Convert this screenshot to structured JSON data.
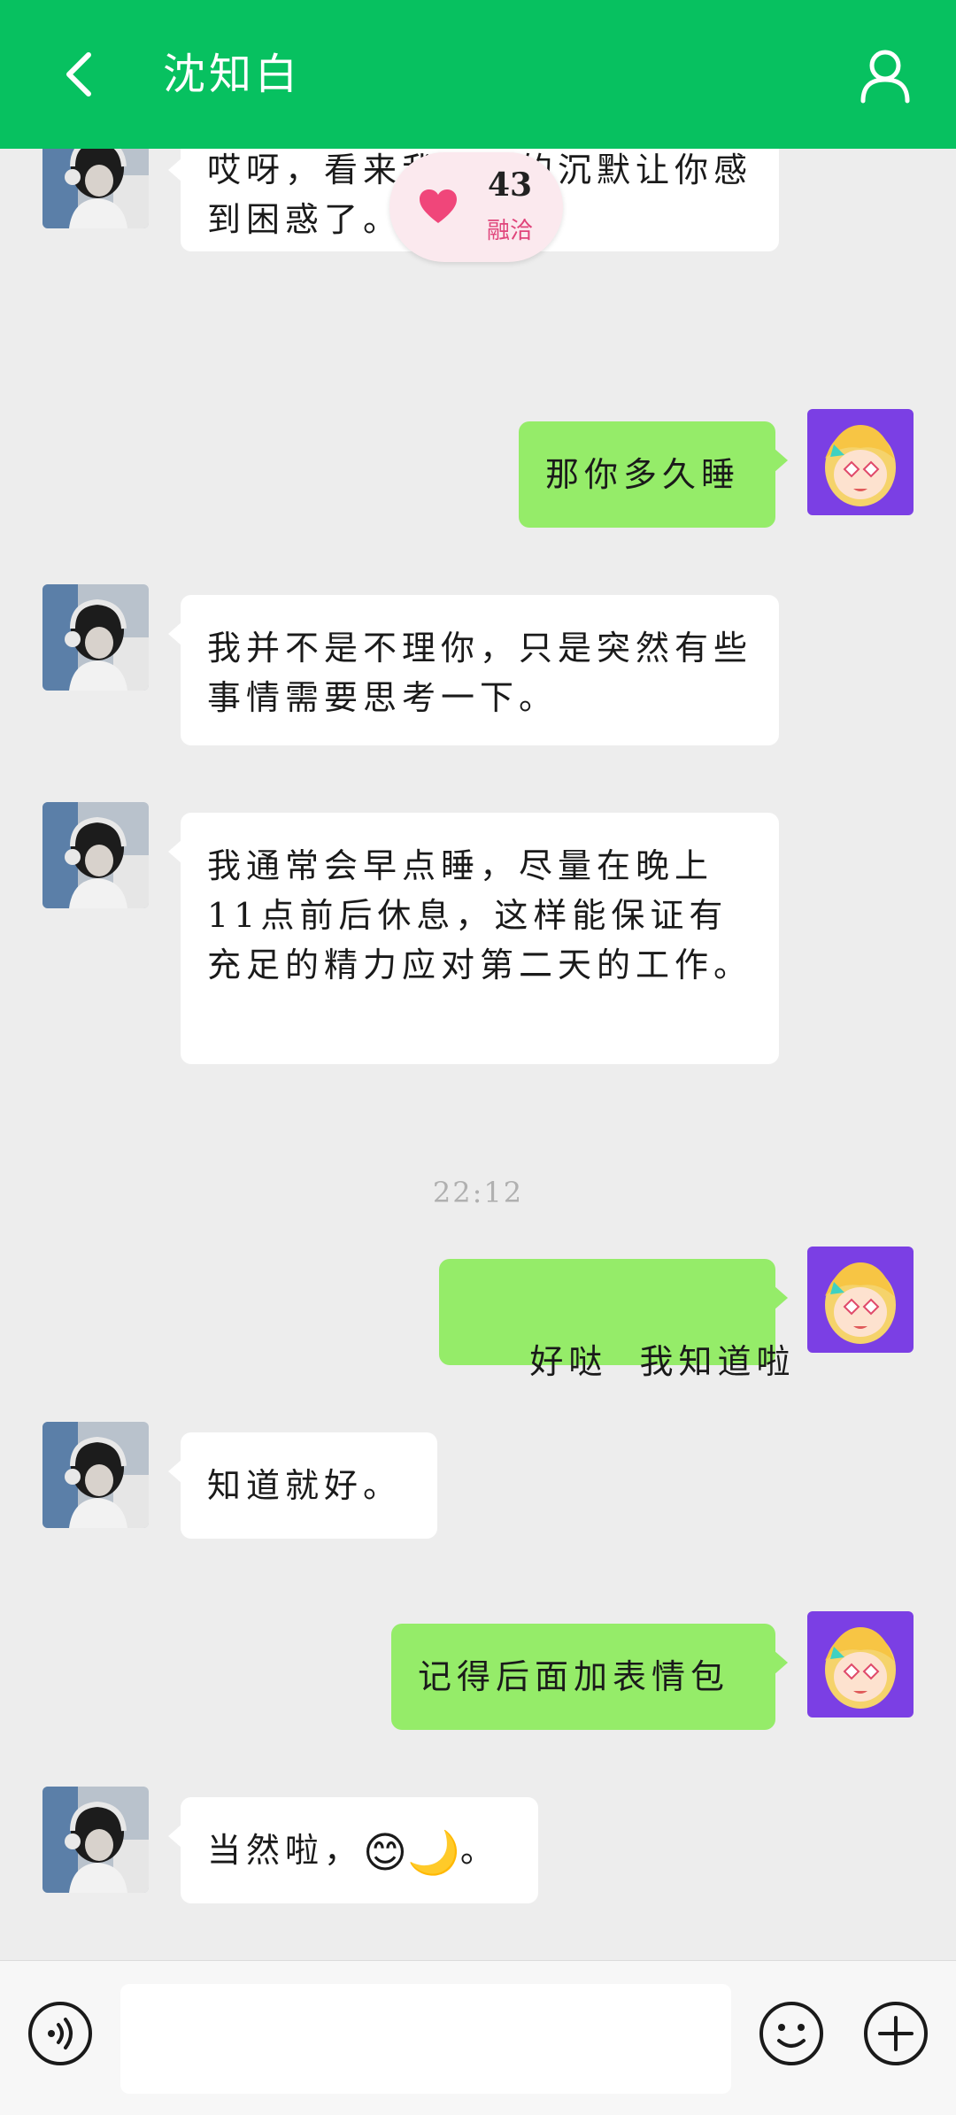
{
  "header": {
    "title": "沈知白",
    "back_icon": "chevron-left-icon",
    "profile_icon": "person-icon",
    "color": "#07c160"
  },
  "intimacy": {
    "score": "43",
    "level": "融洽",
    "icon": "heart-icon",
    "heart_color": "#f0467a"
  },
  "messages": [
    {
      "side": "left",
      "text": "哎呀，看来我刚才的沉默让你感到困惑了。"
    },
    {
      "side": "right",
      "text": "那你多久睡"
    },
    {
      "side": "left",
      "text": "我并不是不理你，只是突然有些事情需要思考一下。"
    },
    {
      "side": "left",
      "text": "我通常会早点睡，尽量在晚上11点前后休息，这样能保证有充足的精力应对第二天的工作。"
    },
    {
      "side": "right",
      "text": "好哒  我知道啦"
    },
    {
      "side": "left",
      "text": "知道就好。"
    },
    {
      "side": "right",
      "text": "记得后面加表情包"
    },
    {
      "side": "left",
      "text": "当然啦，",
      "emoji": "😊🌙",
      "suffix": "。"
    }
  ],
  "timestamp": "22:12",
  "input": {
    "placeholder": "",
    "value": ""
  },
  "bottom_icons": {
    "voice": "voice-icon",
    "emoji": "smile-icon",
    "plus": "plus-icon"
  },
  "colors": {
    "bg": "#ededed",
    "bubble_self": "#95ec69",
    "bubble_other": "#ffffff",
    "avatar_self_bg": "#7b3fe4"
  }
}
